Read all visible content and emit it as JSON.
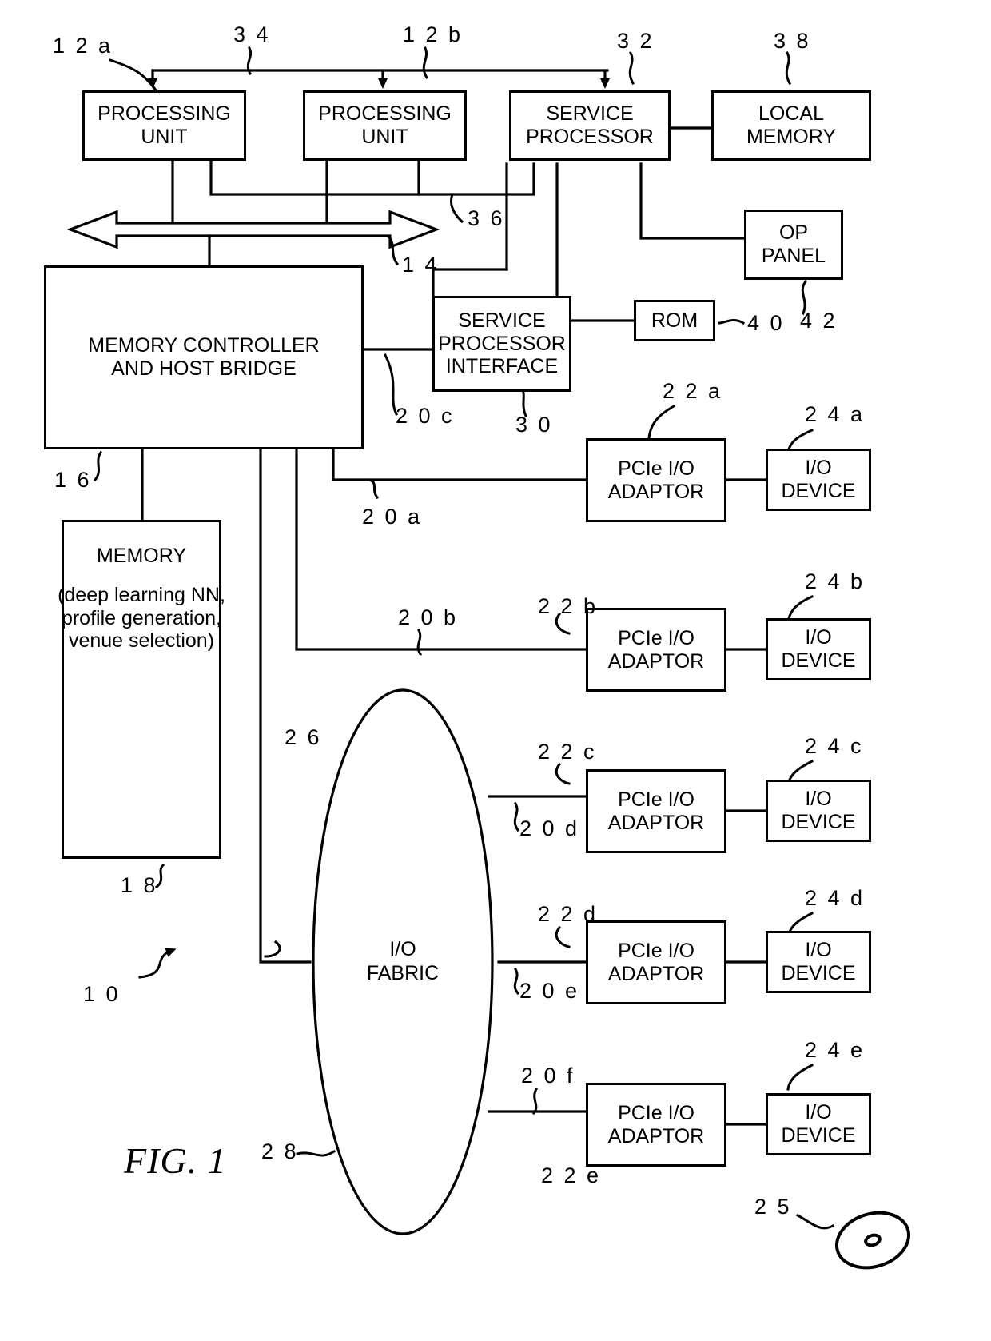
{
  "figure": {
    "label": "FIG. 1",
    "caption_number": "1"
  },
  "blocks": {
    "processing_unit_a": {
      "lines": [
        "PROCESSING",
        "UNIT"
      ],
      "ref": "1 2 a"
    },
    "processing_unit_b": {
      "lines": [
        "PROCESSING",
        "UNIT"
      ],
      "ref": "1 2 b"
    },
    "service_processor": {
      "lines": [
        "SERVICE",
        "PROCESSOR"
      ],
      "ref": "3 2"
    },
    "local_memory": {
      "lines": [
        "LOCAL",
        "MEMORY"
      ],
      "ref": "3 8"
    },
    "op_panel": {
      "lines": [
        "OP",
        "PANEL"
      ],
      "ref": "4 2"
    },
    "rom": {
      "lines": [
        "ROM"
      ],
      "ref": "4 0"
    },
    "memory_controller": {
      "lines": [
        "MEMORY CONTROLLER",
        "AND HOST BRIDGE"
      ],
      "ref": "1 6"
    },
    "service_processor_interface": {
      "lines": [
        "SERVICE",
        "PROCESSOR",
        "INTERFACE"
      ],
      "ref": "3 0"
    },
    "memory": {
      "title": "MEMORY",
      "detail": [
        "(deep learning NN,",
        "profile generation,",
        "venue selection)"
      ],
      "ref": "1 8"
    },
    "io_fabric": {
      "lines": [
        "I/O",
        "FABRIC"
      ],
      "ref": "2 8"
    },
    "adaptors": [
      {
        "lines": [
          "PCIe I/O",
          "ADAPTOR"
        ],
        "ref": "2 2 a"
      },
      {
        "lines": [
          "PCIe I/O",
          "ADAPTOR"
        ],
        "ref": "2 2 b"
      },
      {
        "lines": [
          "PCIe I/O",
          "ADAPTOR"
        ],
        "ref": "2 2 c"
      },
      {
        "lines": [
          "PCIe I/O",
          "ADAPTOR"
        ],
        "ref": "2 2 d"
      },
      {
        "lines": [
          "PCIe I/O",
          "ADAPTOR"
        ],
        "ref": "2 2 e"
      }
    ],
    "devices": [
      {
        "lines": [
          "I/O",
          "DEVICE"
        ],
        "ref": "2 4 a"
      },
      {
        "lines": [
          "I/O",
          "DEVICE"
        ],
        "ref": "2 4 b"
      },
      {
        "lines": [
          "I/O",
          "DEVICE"
        ],
        "ref": "2 4 c"
      },
      {
        "lines": [
          "I/O",
          "DEVICE"
        ],
        "ref": "2 4 d"
      },
      {
        "lines": [
          "I/O",
          "DEVICE"
        ],
        "ref": "2 4 e"
      }
    ],
    "optical_disk": {
      "ref": "2 5"
    }
  },
  "reference_numerals": {
    "system": "1 0",
    "interrupt_bus": "3 4",
    "jtag_i2c_bus": "3 6",
    "system_bus": "1 4",
    "pci_bus_20a": "2 0 a",
    "pci_bus_20b": "2 0 b",
    "pci_bus_20c": "2 0 c",
    "pci_bus_20d": "2 0 d",
    "pci_bus_20e": "2 0 e",
    "pci_bus_20f": "2 0 f",
    "io_bus": "2 6"
  },
  "colors": {
    "ink": "#000000",
    "paper": "#ffffff"
  }
}
